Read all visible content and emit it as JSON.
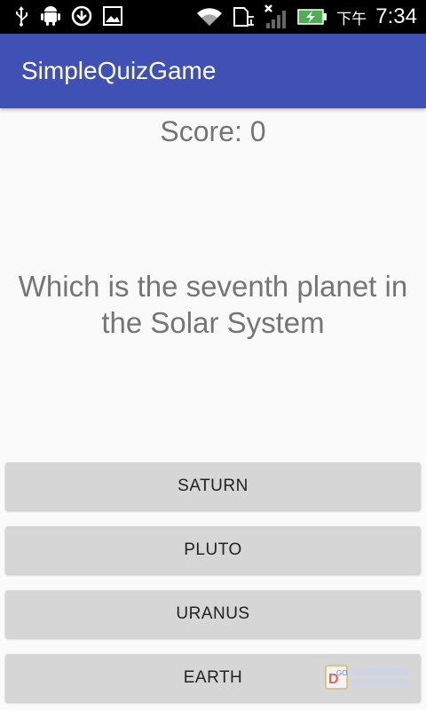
{
  "status_bar": {
    "icons": [
      "usb-icon",
      "android-debug-icon",
      "download-icon",
      "image-icon",
      "wifi-icon",
      "sd-card-icon",
      "signal-icon",
      "battery-charging-icon"
    ],
    "clock_prefix": "下午",
    "clock_time": "7:34"
  },
  "app_bar": {
    "title": "SimpleQuizGame",
    "color": "#3f51b5"
  },
  "quiz": {
    "score_text": "Score: 0",
    "question": "Which is the seventh planet in the Solar System",
    "answers": [
      "SATURN",
      "PLUTO",
      "URANUS",
      "EARTH"
    ]
  }
}
